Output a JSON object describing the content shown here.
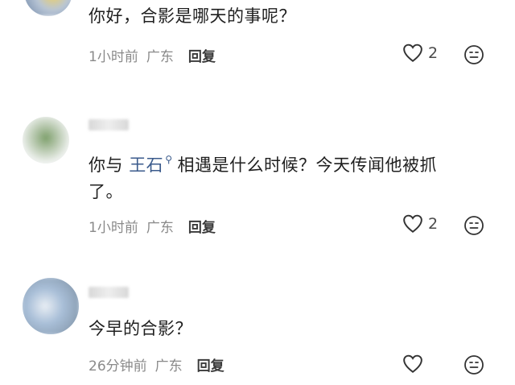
{
  "comments": [
    {
      "text": "你好，合影是哪天的事呢？",
      "time": "1小时前",
      "location": "广东",
      "reply_label": "回复",
      "like_count": "2"
    },
    {
      "text_before": "你与",
      "mention": "王石",
      "text_after": "相遇是什么时候？今天传闻他被抓",
      "text_line2": "了。",
      "time": "1小时前",
      "location": "广东",
      "reply_label": "回复",
      "like_count": "2"
    },
    {
      "text": "今早的合影？",
      "time": "26分钟前",
      "location": "广东",
      "reply_label": "回复",
      "like_count": ""
    }
  ],
  "icons": {
    "like": "heart-outline-icon",
    "reaction": "emoji-face-icon",
    "mention": "search-icon"
  },
  "colors": {
    "link": "#3b5b8c",
    "meta": "#8a8a8a",
    "text": "#1f1f1f"
  }
}
